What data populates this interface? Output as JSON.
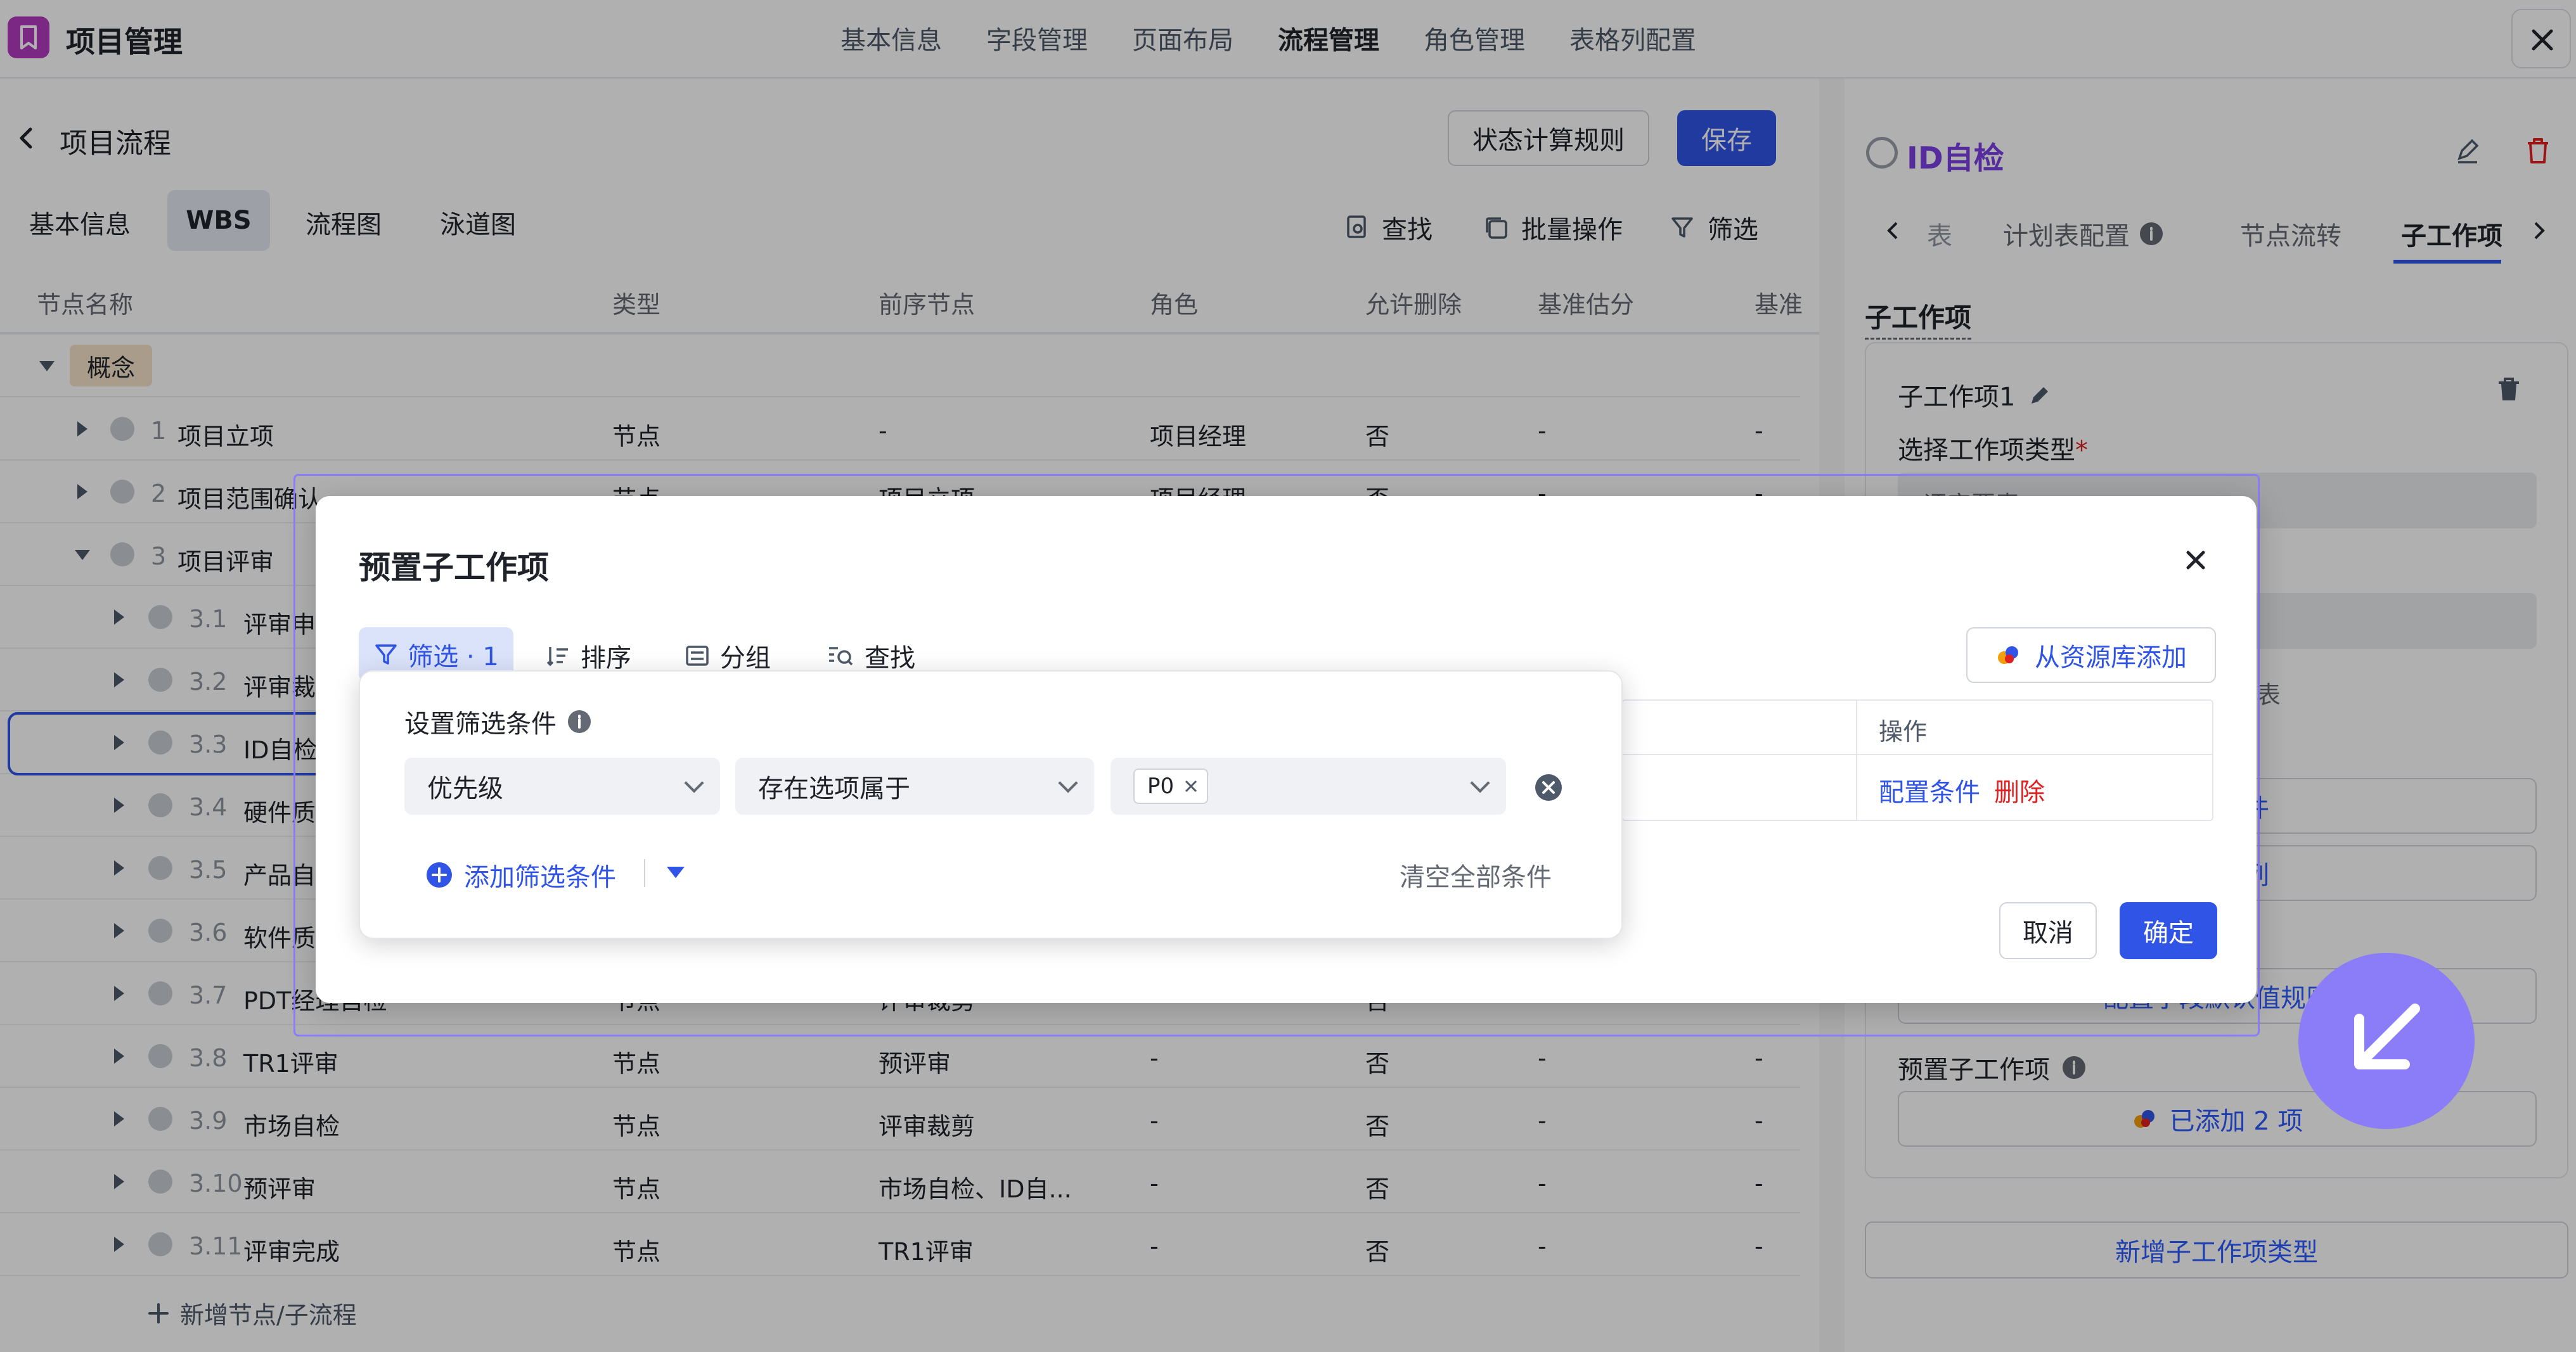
{
  "app": {
    "title": "项目管理"
  },
  "nav": {
    "items": [
      "基本信息",
      "字段管理",
      "页面布局",
      "流程管理",
      "角色管理",
      "表格列配置"
    ],
    "active_index": 3
  },
  "page": {
    "title": "项目流程",
    "state_rules_label": "状态计算规则",
    "save_label": "保存"
  },
  "subtabs": {
    "items": [
      "基本信息",
      "WBS",
      "流程图",
      "泳道图"
    ],
    "active_index": 1
  },
  "toolbar": {
    "search_label": "查找",
    "batch_label": "批量操作",
    "filter_label": "筛选"
  },
  "table": {
    "columns": [
      "节点名称",
      "类型",
      "前序节点",
      "角色",
      "允许删除",
      "基准估分",
      "基准"
    ],
    "group_label": "概念",
    "rows": [
      {
        "num": "1",
        "name": "项目立项",
        "type": "节点",
        "pre": "-",
        "role": "项目经理",
        "del": "否",
        "score": "-",
        "base": "-"
      },
      {
        "num": "2",
        "name": "项目范围确认",
        "type": "节点",
        "pre": "项目立项",
        "role": "项目经理",
        "del": "否",
        "score": "-",
        "base": "-"
      },
      {
        "num": "3",
        "name": "项目评审",
        "type": "",
        "pre": "",
        "role": "",
        "del": "",
        "score": "",
        "base": ""
      },
      {
        "num": "3.1",
        "name": "评审申",
        "type": "",
        "pre": "",
        "role": "",
        "del": "",
        "score": "",
        "base": ""
      },
      {
        "num": "3.2",
        "name": "评审裁",
        "type": "",
        "pre": "",
        "role": "",
        "del": "",
        "score": "",
        "base": ""
      },
      {
        "num": "3.3",
        "name": "ID自检",
        "type": "",
        "pre": "",
        "role": "",
        "del": "",
        "score": "",
        "base": ""
      },
      {
        "num": "3.4",
        "name": "硬件质",
        "type": "",
        "pre": "",
        "role": "",
        "del": "",
        "score": "",
        "base": ""
      },
      {
        "num": "3.5",
        "name": "产品自",
        "type": "",
        "pre": "",
        "role": "",
        "del": "",
        "score": "",
        "base": ""
      },
      {
        "num": "3.6",
        "name": "软件质",
        "type": "",
        "pre": "",
        "role": "",
        "del": "",
        "score": "",
        "base": ""
      },
      {
        "num": "3.7",
        "name": "PDT经理自检",
        "type": "节点",
        "pre": "评审裁剪",
        "role": "",
        "del": "否",
        "score": "",
        "base": ""
      },
      {
        "num": "3.8",
        "name": "TR1评审",
        "type": "节点",
        "pre": "预评审",
        "role": "-",
        "del": "否",
        "score": "-",
        "base": "-"
      },
      {
        "num": "3.9",
        "name": "市场自检",
        "type": "节点",
        "pre": "评审裁剪",
        "role": "-",
        "del": "否",
        "score": "-",
        "base": "-"
      },
      {
        "num": "3.10",
        "name": "预评审",
        "type": "节点",
        "pre": "市场自检、ID自...",
        "role": "-",
        "del": "否",
        "score": "-",
        "base": "-"
      },
      {
        "num": "3.11",
        "name": "评审完成",
        "type": "节点",
        "pre": "TR1评审",
        "role": "-",
        "del": "否",
        "score": "-",
        "base": "-"
      }
    ],
    "add_label": "新增节点/子流程"
  },
  "right": {
    "title": "ID自检",
    "tabs": [
      "计划表配置",
      "节点流转",
      "子工作项"
    ],
    "tab_fragment": "表",
    "section_title": "子工作项",
    "item_name": "子工作项1",
    "type_label": "选择工作项类型",
    "type_value": "评审要素",
    "fragment_text": "表",
    "btn1": "分条件",
    "btn2": "可见列",
    "btn3": "配置字段默认值规则",
    "preset_label": "预置子工作项",
    "added_label": "已添加 2 项",
    "add_type_label": "新增子工作项类型"
  },
  "modal": {
    "title": "预置子工作项",
    "tools": {
      "filter": "筛选 · 1",
      "sort": "排序",
      "group": "分组",
      "find": "查找"
    },
    "library_btn": "从资源库添加",
    "ops_header": "操作",
    "ops": {
      "config": "配置条件",
      "delete": "删除"
    },
    "cancel": "取消",
    "confirm": "确定"
  },
  "filter": {
    "title": "设置筛选条件",
    "field": "优先级",
    "operator": "存在选项属于",
    "tag": "P0",
    "add_label": "添加筛选条件",
    "clear_label": "清空全部条件"
  },
  "colors": {
    "primary": "#3054e6",
    "danger": "#e02020",
    "brand": "#b13bbf",
    "accent": "#8b7cf7"
  }
}
